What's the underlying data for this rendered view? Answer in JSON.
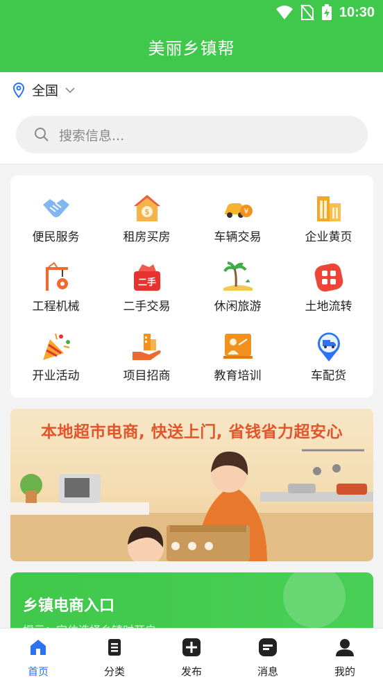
{
  "status_bar": {
    "time": "10:30",
    "icons": [
      "wifi-icon",
      "no-sim-icon",
      "battery-charging-icon"
    ]
  },
  "app_bar": {
    "title": "美丽乡镇帮"
  },
  "location": {
    "label": "全国"
  },
  "search": {
    "placeholder": "搜索信息..."
  },
  "categories": [
    {
      "label": "便民服务",
      "icon": "handshake-icon"
    },
    {
      "label": "租房买房",
      "icon": "house-coin-icon"
    },
    {
      "label": "车辆交易",
      "icon": "car-coin-icon"
    },
    {
      "label": "企业黄页",
      "icon": "buildings-icon"
    },
    {
      "label": "工程机械",
      "icon": "crane-icon"
    },
    {
      "label": "二手交易",
      "icon": "secondhand-basket-icon"
    },
    {
      "label": "休闲旅游",
      "icon": "palm-tree-icon"
    },
    {
      "label": "土地流转",
      "icon": "land-grid-icon"
    },
    {
      "label": "开业活动",
      "icon": "party-popper-icon"
    },
    {
      "label": "项目招商",
      "icon": "investment-hand-icon"
    },
    {
      "label": "教育培训",
      "icon": "teacher-board-icon"
    },
    {
      "label": "车配货",
      "icon": "truck-pin-icon"
    }
  ],
  "banner": {
    "headline": "本地超市电商, 快送上门, 省钱省力超安心",
    "slide_count": 3
  },
  "promo": {
    "title": "乡镇电商入口",
    "hint": "提示：定位选择乡镇时开启"
  },
  "tabs": [
    {
      "label": "首页",
      "icon": "home-icon",
      "active": true
    },
    {
      "label": "分类",
      "icon": "category-list-icon",
      "active": false
    },
    {
      "label": "发布",
      "icon": "plus-square-icon",
      "active": false
    },
    {
      "label": "消息",
      "icon": "message-icon",
      "active": false
    },
    {
      "label": "我的",
      "icon": "user-icon",
      "active": false
    }
  ],
  "colors": {
    "primary_green": "#40c84c",
    "active_tab_blue": "#2b73f0",
    "banner_text": "#e2542a"
  }
}
